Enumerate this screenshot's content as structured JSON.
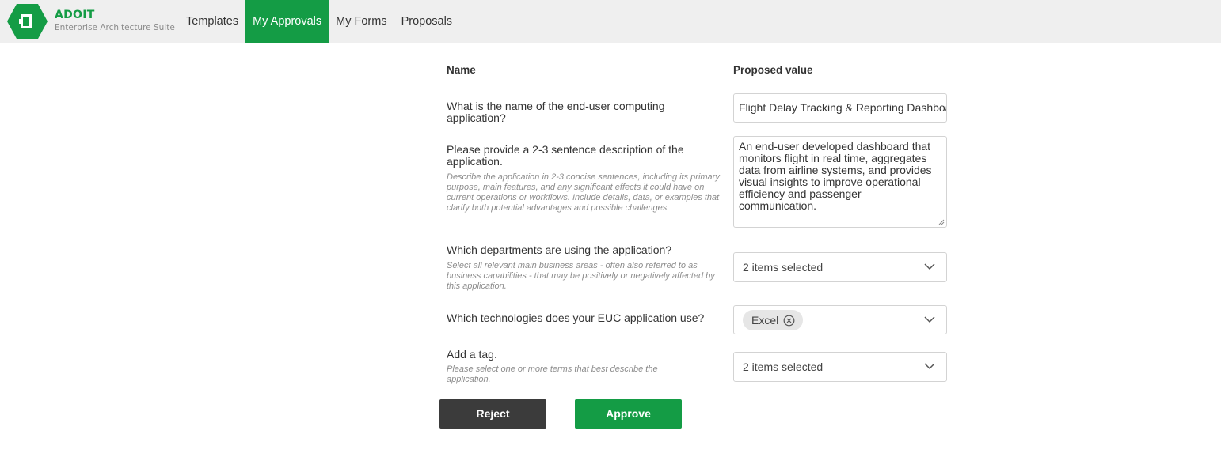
{
  "app": {
    "brand_name": "ADOIT",
    "brand_subtitle": "Enterprise Architecture Suite",
    "accent_color": "#149c45"
  },
  "nav": {
    "items": [
      {
        "label": "Templates",
        "active": false
      },
      {
        "label": "My Approvals",
        "active": true
      },
      {
        "label": "My Forms",
        "active": false
      },
      {
        "label": "Proposals",
        "active": false
      }
    ]
  },
  "table": {
    "name_header": "Name",
    "value_header": "Proposed value"
  },
  "fields": {
    "app_name": {
      "question": "What is the name of the end-user computing application?",
      "value": "Flight Delay Tracking & Reporting Dashboa"
    },
    "description": {
      "question": "Please provide a 2-3 sentence description of the application.",
      "help": "Describe the application in 2-3 concise sentences, including its primary purpose, main features, and any significant effects it could have on current operations or workflows. Include details, data, or examples that clarify both potential advantages and possible challenges.",
      "value": "An end-user developed dashboard that monitors flight in real time, aggregates data from airline systems, and provides visual insights to improve operational efficiency and passenger communication."
    },
    "departments": {
      "question": "Which departments are using the application?",
      "help": "Select all relevant main business areas - often also referred to as business capabilities - that may be positively or negatively affected by this application.",
      "value": "2 items selected"
    },
    "technologies": {
      "question": "Which technologies does your EUC application use?",
      "chip": "Excel"
    },
    "tags": {
      "question": "Add a tag.",
      "help": "Please select one or more terms that best describe the application.",
      "value": "2 items selected"
    }
  },
  "actions": {
    "reject_label": "Reject",
    "approve_label": "Approve"
  }
}
